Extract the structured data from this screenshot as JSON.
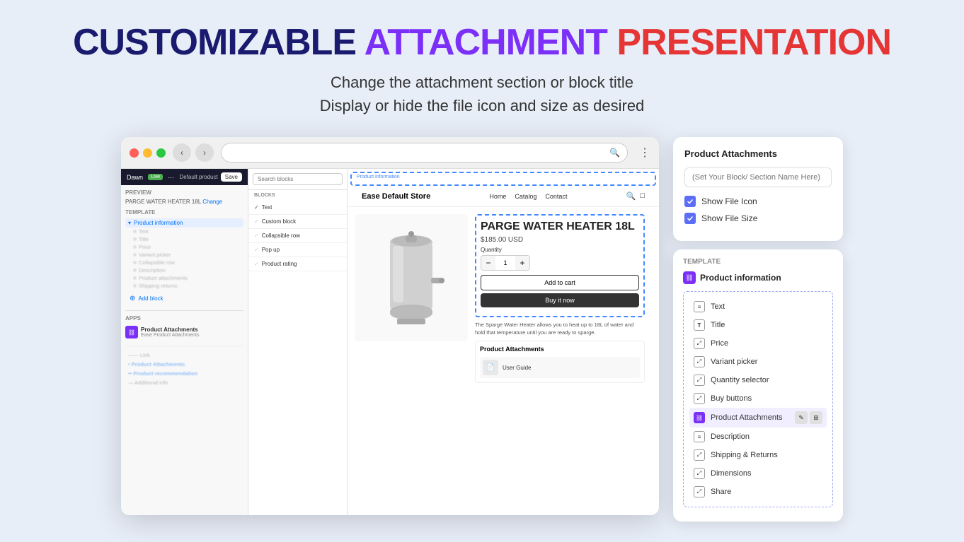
{
  "hero": {
    "title_part1": "CUSTOMIZABLE",
    "title_part2": "ATTACHMENT",
    "title_part3": "PRESENTATION",
    "subtitle_line1": "Change the attachment section or block title",
    "subtitle_line2": "Display or hide the file icon and size as desired"
  },
  "browser": {
    "address": "",
    "theme_name": "Dawn",
    "live_badge": "Live",
    "product_select": "Default product",
    "save_button": "Save"
  },
  "sidebar": {
    "default_product": "Default product",
    "preview_label": "PREVIEW",
    "preview_product": "PARGE WATER HEATER 18L",
    "change_link": "Change",
    "template_label": "TEMPLATE",
    "product_info_section": "Product information",
    "add_block": "Add block",
    "apps_label": "APPS",
    "app_name": "Product Attachments",
    "app_sub": "Ease Product Attachments"
  },
  "blocks_panel": {
    "search_placeholder": "Search blocks",
    "items": [
      {
        "label": "Text",
        "type": "block"
      },
      {
        "label": "Custom block",
        "type": "block"
      },
      {
        "label": "Collapsible row",
        "type": "block"
      },
      {
        "label": "Pop up",
        "type": "block"
      },
      {
        "label": "Product rating",
        "type": "block"
      }
    ]
  },
  "store": {
    "logo": "Ease Default Store",
    "nav_links": [
      "Home",
      "Catalog",
      "Contact"
    ],
    "product_title": "PARGE WATER HEATER 18L",
    "product_price": "$185.00 USD",
    "quantity_label": "Quantity",
    "quantity_value": "1",
    "add_to_cart": "Add to cart",
    "buy_now": "Buy it now",
    "description": "The Sparge Water Heater allows you to heat up to 18L of water and hold that temperature until you are ready to sparge.",
    "attachments_title": "Product Attachments",
    "attachment_name": "User Guide"
  },
  "settings": {
    "panel_title": "Product Attachments",
    "input_placeholder": "(Set Your Block/ Section Name Here)",
    "show_file_icon_label": "Show File Icon",
    "show_file_size_label": "Show File Size"
  },
  "template": {
    "section_label": "TEMPLATE",
    "section_name": "Product information",
    "items": [
      {
        "label": "Text",
        "icon_type": "text"
      },
      {
        "label": "Title",
        "icon_type": "title"
      },
      {
        "label": "Price",
        "icon_type": "expand"
      },
      {
        "label": "Variant picker",
        "icon_type": "expand"
      },
      {
        "label": "Quantity selector",
        "icon_type": "expand"
      },
      {
        "label": "Buy buttons",
        "icon_type": "expand"
      },
      {
        "label": "Product Attachments",
        "icon_type": "app",
        "highlighted": true
      },
      {
        "label": "Description",
        "icon_type": "text"
      },
      {
        "label": "Shipping & Returns",
        "icon_type": "expand"
      },
      {
        "label": "Dimensions",
        "icon_type": "expand"
      },
      {
        "label": "Share",
        "icon_type": "expand"
      }
    ]
  }
}
